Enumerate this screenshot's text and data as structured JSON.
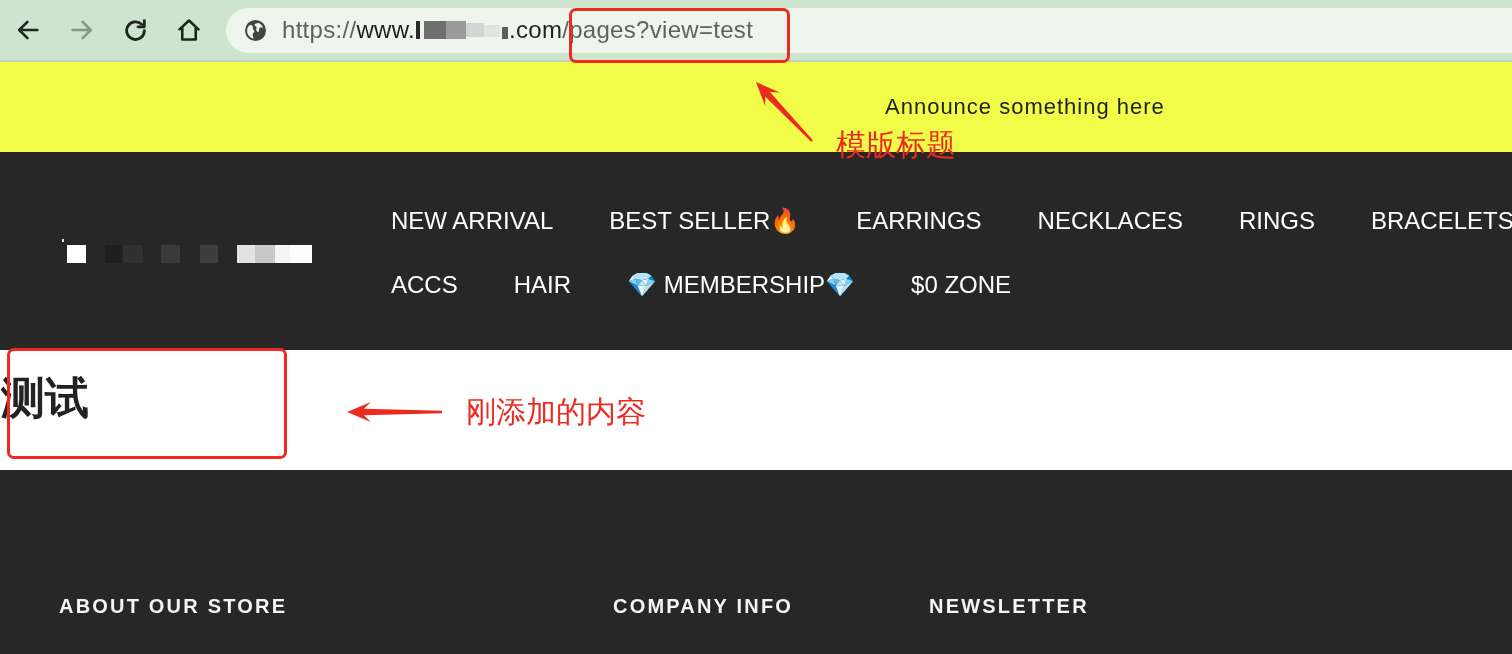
{
  "browser": {
    "buttons": [
      {
        "kind": "back",
        "disabled": false
      },
      {
        "kind": "forward",
        "disabled": true
      },
      {
        "kind": "reload",
        "disabled": false
      },
      {
        "kind": "home",
        "disabled": false
      }
    ],
    "address": {
      "segments": [
        {
          "kind": "dim",
          "text": "https://"
        },
        {
          "kind": "bright",
          "text": "www."
        },
        {
          "kind": "redacted"
        },
        {
          "kind": "bright",
          "text": ".com"
        },
        {
          "kind": "dim",
          "text": "/pages?view=test"
        }
      ]
    }
  },
  "announcement": {
    "text": "Announce something here"
  },
  "header": {
    "nav": {
      "rows": [
        {
          "items": [
            {
              "label": "NEW ARRIVAL"
            },
            {
              "label": "BEST SELLER🔥"
            },
            {
              "label": "EARRINGS"
            },
            {
              "label": "NECKLACES"
            },
            {
              "label": "RINGS"
            },
            {
              "label": "BRACELETS"
            }
          ]
        },
        {
          "items": [
            {
              "label": "ACCS"
            },
            {
              "label": "HAIR"
            },
            {
              "label": "💎 MEMBERSHIP💎"
            },
            {
              "label": "$0 ZONE"
            }
          ]
        }
      ]
    }
  },
  "page": {
    "heading": "测试"
  },
  "footer": {
    "columns": [
      {
        "heading": "ABOUT OUR STORE"
      },
      {
        "heading": "COMPANY INFO"
      },
      {
        "heading": "NEWSLETTER"
      }
    ]
  },
  "annotations": [
    {
      "label": "模版标题"
    },
    {
      "label": "刚添加的内容"
    }
  ]
}
